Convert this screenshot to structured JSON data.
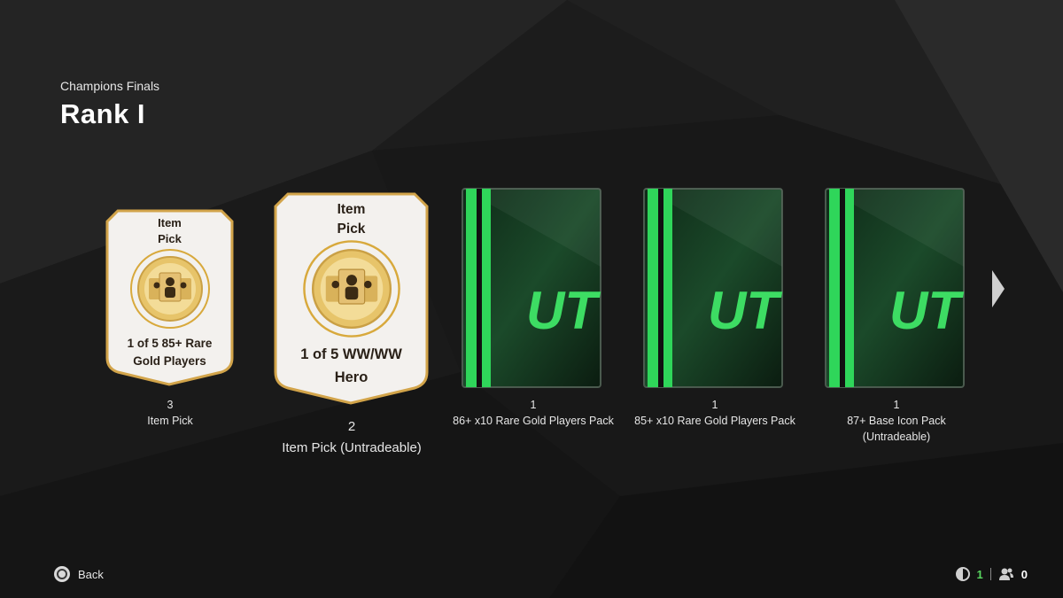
{
  "header": {
    "subtitle": "Champions Finals",
    "title": "Rank I"
  },
  "rewards": [
    {
      "kind": "item-pick",
      "card_line1": "Item",
      "card_line2": "Pick",
      "card_desc1": "1 of 5 85+ Rare",
      "card_desc2": "Gold Players",
      "quantity": "3",
      "label": "Item Pick",
      "label2": ""
    },
    {
      "kind": "item-pick",
      "card_line1": "Item",
      "card_line2": "Pick",
      "card_desc1": "1 of 5 WW/WW",
      "card_desc2": "Hero",
      "quantity": "2",
      "label": "Item Pick (Untradeable)",
      "label2": ""
    },
    {
      "kind": "pack",
      "pack_logo": "UT",
      "quantity": "1",
      "label": "86+ x10 Rare Gold Players Pack",
      "label2": ""
    },
    {
      "kind": "pack",
      "pack_logo": "UT",
      "quantity": "1",
      "label": "85+ x10 Rare Gold Players Pack",
      "label2": ""
    },
    {
      "kind": "pack",
      "pack_logo": "UT",
      "quantity": "1",
      "label": "87+ Base Icon Pack",
      "label2": "(Untradeable)"
    }
  ],
  "footer": {
    "back_label": "Back",
    "status_count_1": "1",
    "status_count_2": "0"
  },
  "colors": {
    "accent_green": "#39d353",
    "gold": "#d8a93c",
    "card_bg": "#f3f1ee"
  },
  "icons": {
    "next": "chevron-right-icon",
    "back": "circle-button-icon",
    "status1": "shield-icon",
    "status2": "friends-icon"
  }
}
